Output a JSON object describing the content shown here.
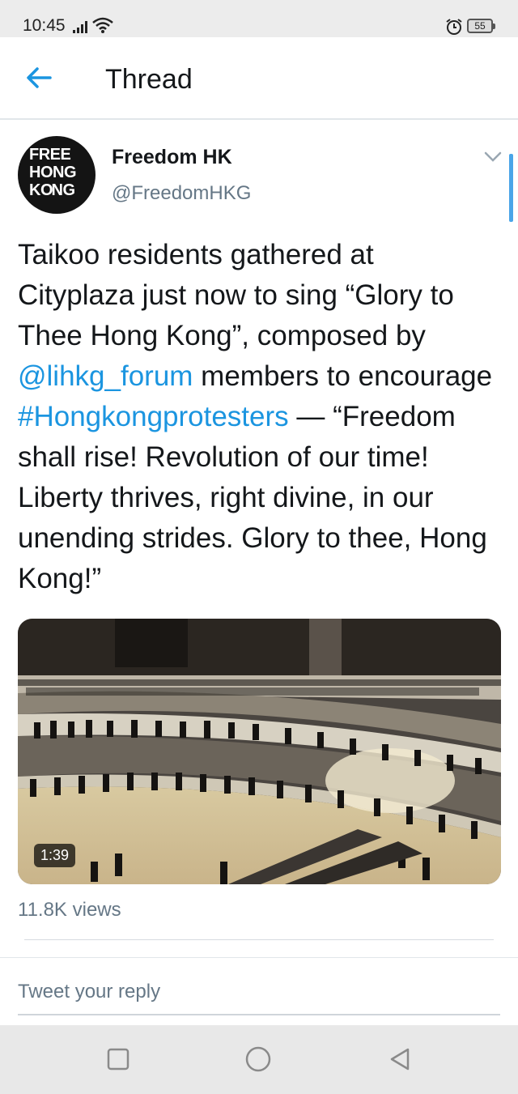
{
  "status_bar": {
    "time": "10:45",
    "battery": "55",
    "icons": [
      "signal-icon",
      "wifi-icon",
      "alarm-icon",
      "battery-icon"
    ]
  },
  "header": {
    "title": "Thread",
    "back_icon": "arrow-left-icon"
  },
  "tweet": {
    "avatar_text": "FREE\nHONG\nKONG",
    "author_name": "Freedom HK",
    "author_handle": "@FreedomHKG",
    "text_parts": {
      "p1": "Taikoo residents gathered at Cityplaza just now to sing “Glory to Thee Hong Kong”, composed by ",
      "mention": "@lihkg_forum",
      "p2": " members to encourage ",
      "hashtag": "#Hongkongprotesters",
      "p3": " — “Freedom shall rise! Revolution of our time! Liberty thrives, right divine, in our unending strides. Glory to thee, Hong Kong!”"
    },
    "video_duration": "1:39",
    "views": "11.8K views"
  },
  "reply": {
    "placeholder": "Tweet your reply"
  },
  "colors": {
    "accent": "#1b95e0",
    "text": "#14171a",
    "secondary": "#657786"
  },
  "nav_bar": {
    "buttons": [
      "recent-apps-icon",
      "home-icon",
      "back-icon"
    ]
  }
}
